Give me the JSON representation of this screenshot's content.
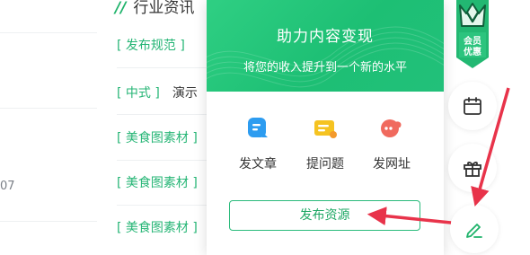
{
  "left_panel": {
    "date_fragment": "07"
  },
  "main": {
    "section_title": "行业资讯",
    "rows": [
      {
        "tag": "[ 发布规范 ]",
        "text": ""
      },
      {
        "tag": "[ 中式 ]",
        "text": "演示"
      },
      {
        "tag": "[ 美食图素材 ]",
        "text": ""
      },
      {
        "tag": "[ 美食图素材 ]",
        "text": ""
      },
      {
        "tag": "[ 美食图素材 ]",
        "text": ""
      }
    ]
  },
  "popup": {
    "title": "助力内容变现",
    "subtitle": "将您的收入提升到一个新的水平",
    "actions": [
      {
        "label": "发文章",
        "icon": "article-icon",
        "color": "#2d9cf0"
      },
      {
        "label": "提问题",
        "icon": "question-icon",
        "color": "#f5c321"
      },
      {
        "label": "发网址",
        "icon": "link-icon",
        "color": "#f06a5e"
      }
    ],
    "publish_label": "发布资源"
  },
  "sidebar": {
    "vip_badge": {
      "line1": "会员",
      "line2": "优惠",
      "color": "#22b872"
    },
    "buttons": [
      {
        "icon": "calendar-icon"
      },
      {
        "icon": "gift-icon"
      },
      {
        "icon": "pencil-icon",
        "color": "#1fb36b"
      }
    ]
  },
  "colors": {
    "accent": "#1fb36b",
    "annotation_arrow": "#e8334a"
  }
}
